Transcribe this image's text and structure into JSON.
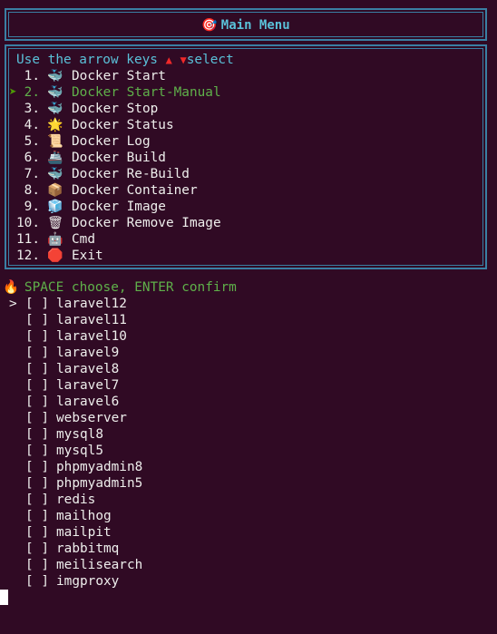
{
  "window": {
    "title": "Main Menu",
    "title_icon": "🎯"
  },
  "hint": {
    "text": "Use the arrow keys",
    "up": "▲",
    "down": "▼",
    "suffix": "select"
  },
  "menu": {
    "selected_index": 1,
    "selected_marker": "➤",
    "items": [
      {
        "num": "1.",
        "icon": "🐳",
        "label": "Docker Start"
      },
      {
        "num": "2.",
        "icon": "🐳",
        "label": "Docker Start-Manual"
      },
      {
        "num": "3.",
        "icon": "🐳",
        "label": "Docker Stop"
      },
      {
        "num": "4.",
        "icon": "🌟",
        "label": "Docker Status"
      },
      {
        "num": "5.",
        "icon": "📜",
        "label": "Docker Log"
      },
      {
        "num": "6.",
        "icon": "🚢",
        "label": "Docker Build"
      },
      {
        "num": "7.",
        "icon": "🐳",
        "label": "Docker Re-Build"
      },
      {
        "num": "8.",
        "icon": "📦",
        "label": "Docker Container"
      },
      {
        "num": "9.",
        "icon": "🧊",
        "label": "Docker Image"
      },
      {
        "num": "10.",
        "icon": "🗑",
        "label": "Docker Remove Image"
      },
      {
        "num": "11.",
        "icon": "🤖",
        "label": "Cmd"
      },
      {
        "num": "12.",
        "icon": "🛑",
        "label": "Exit"
      }
    ]
  },
  "prompt": {
    "icon": "🔥",
    "text": "SPACE choose, ENTER confirm"
  },
  "options": {
    "pointer": ">",
    "checkbox": "[ ]",
    "items": [
      "laravel12",
      "laravel11",
      "laravel10",
      "laravel9",
      "laravel8",
      "laravel7",
      "laravel6",
      "webserver",
      "mysql8",
      "mysql5",
      "phpmyadmin8",
      "phpmyadmin5",
      "redis",
      "mailhog",
      "mailpit",
      "rabbitmq",
      "meilisearch",
      "imgproxy"
    ]
  },
  "colors": {
    "background": "#300a24",
    "border": "#3a7fa3",
    "accent_cyan": "#5ac0d8",
    "selected_green": "#5fb04a",
    "arrow_red": "#ef2929"
  }
}
